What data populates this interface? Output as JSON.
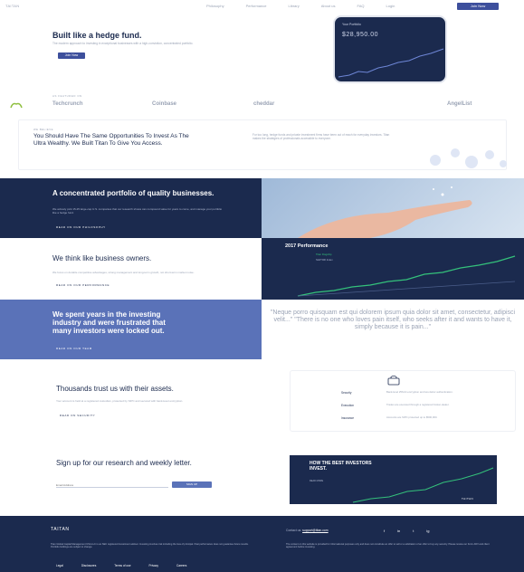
{
  "nav": {
    "logo": "TAITAN",
    "links": [
      "Philosophy",
      "Performance",
      "Library",
      "About us",
      "FAQ",
      "Login"
    ],
    "join_label": "Join Now"
  },
  "hero": {
    "title": "Built like a hedge fund.",
    "subtitle": "The modern approach to investing in exceptional businesses with a high-conviction, concentrated portfolio.",
    "cta_label": "Join Now",
    "phone": {
      "title": "Your Portfolio",
      "value": "$28,950.00"
    }
  },
  "logos": {
    "featured_label": "AS FEATURED ON",
    "items": [
      "Techcrunch",
      "Coinbase",
      "cheddar",
      "AngelList"
    ]
  },
  "mission": {
    "eyebrow": "WE BELIEVE",
    "heading": "You Should Have The Same Opportunities To Invest As The Ultra Wealthy. We Built Titan To Give You Access.",
    "copy": "For too long, hedge funds and private investment firms have been out of reach for everyday investors. Titan makes the strategies of professionals accessible to everyone."
  },
  "band1": {
    "title": "A concentrated portfolio of quality businesses.",
    "copy": "We actively pick 15-25 large-cap U.S. companies that our research shows can compound value for years to come, and manage your portfolio like a hedge fund.",
    "cta": "READ ON OUR PHILOSOPHY"
  },
  "band2": {
    "title": "We think like business owners.",
    "copy": "We focus on durable competitive advantages, strong management and long-term growth, not short-term market noise.",
    "cta": "READ ON OUR PERFORMANCE",
    "chart_title": "2017 Performance",
    "legend": [
      "Titan Flagship",
      "S&P 500 Index"
    ]
  },
  "band3": {
    "title": "We spent years in the investing industry and were frustrated that many investors were locked out.",
    "cta": "READ ON OUR TEAM",
    "quote": "\"Neque porro quisquam est qui dolorem ipsum quia dolor sit amet, consectetur, adipisci velit...\" \"There is no one who loves pain itself, who seeks after it and wants to have it, simply because it is pain...\""
  },
  "trust": {
    "title": "Thousands trust us with their assets.",
    "copy": "Your account is held at a registered custodian, protected by SIPC and secured with bank-level encryption.",
    "cta": "READ ON SECURITY",
    "rows": [
      {
        "label": "Security",
        "value": "Bank-level 256-bit encryption and two-factor authentication."
      },
      {
        "label": "Execution",
        "value": "Trades are executed through a registered broker-dealer."
      },
      {
        "label": "Insurance",
        "value": "Accounts are SIPC protected up to $500,000."
      }
    ]
  },
  "newsletter": {
    "title": "Sign up for our research and weekly letter.",
    "placeholder": "Email Address",
    "button": "SIGN UP",
    "card_title": "HOW THE BEST INVESTORS INVEST.",
    "card_sub": "READ MORE",
    "card_brand": "TAITAN"
  },
  "footer": {
    "logo": "TAITAN",
    "contact_label": "Contact us:",
    "contact_email": "support@titan.com",
    "social": [
      "f",
      "in",
      "t",
      "ig"
    ],
    "copy_left": "Titan Global Capital Management USA LLC is an SEC registered investment adviser. Investing involves risk including the loss of principal. Past performance does not guarantee future results. Portfolio holdings are subject to change.",
    "copy_right": "The content on this website is provided for informational purposes only and does not constitute an offer to sell or a solicitation of an offer to buy any security. Please review our Form ADV and client agreement before investing.",
    "links": [
      "Legal",
      "Disclosures",
      "Terms of use",
      "Privacy",
      "Careers"
    ]
  },
  "colors": {
    "navy": "#1b2a4e",
    "accent": "#3d4f9c",
    "periwinkle": "#5a72b8",
    "chart_green": "#34c17b"
  }
}
